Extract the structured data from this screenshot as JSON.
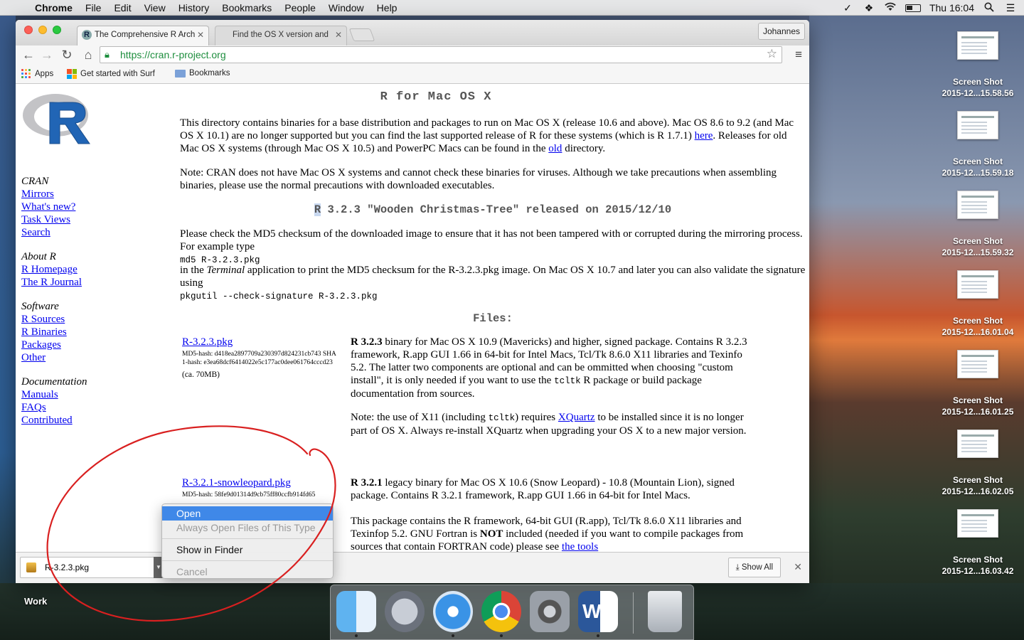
{
  "menubar": {
    "app_name": "Chrome",
    "items": [
      "File",
      "Edit",
      "View",
      "History",
      "Bookmarks",
      "People",
      "Window",
      "Help"
    ],
    "clock": "Thu 16:04"
  },
  "browser": {
    "tabs": [
      {
        "title": "The Comprehensive R Arch",
        "active": true
      },
      {
        "title": "Find the OS X version and",
        "active": false
      }
    ],
    "profile": "Johannes",
    "url": "https://cran.r-project.org",
    "bookmarks": {
      "apps": "Apps",
      "surf": "Get started with Surf",
      "folder": "Bookmarks"
    }
  },
  "sidebar": {
    "cran": {
      "heading": "CRAN",
      "links": [
        "Mirrors",
        "What's new?",
        "Task Views",
        "Search"
      ]
    },
    "about": {
      "heading": "About R",
      "links": [
        "R Homepage",
        "The R Journal"
      ]
    },
    "software": {
      "heading": "Software",
      "links": [
        "R Sources",
        "R Binaries",
        "Packages",
        "Other"
      ]
    },
    "docs": {
      "heading": "Documentation",
      "links": [
        "Manuals",
        "FAQs",
        "Contributed"
      ]
    }
  },
  "content": {
    "title": "R for Mac OS X",
    "intro_1": "This directory contains binaries for a base distribution and packages to run on Mac OS X (release 10.6 and above). Mac OS 8.6 to 9.2 (and Mac OS X 10.1) are no longer supported but you can find the last supported release of R for these systems (which is R 1.7.1) ",
    "intro_link_here": "here",
    "intro_2": ". Releases for old Mac OS X systems (through Mac OS X 10.5) and PowerPC Macs can be found in the ",
    "intro_link_old": "old",
    "intro_3": " directory.",
    "note": "Note: CRAN does not have Mac OS X systems and cannot check these binaries for viruses. Although we take precautions when assembling binaries, please use the normal precautions with downloaded executables.",
    "release_r": "R",
    "release_rest": " 3.2.3 \"Wooden Christmas-Tree\" released on 2015/12/10",
    "md5_text": "Please check the MD5 checksum of the downloaded image to ensure that it has not been tampered with or corrupted during the mirroring process. For example type",
    "md5_cmd": "md5 R-3.2.3.pkg",
    "in_the": "in the ",
    "terminal": "Terminal",
    "md5_after": " application to print the MD5 checksum for the R-3.2.3.pkg image. On Mac OS X 10.7 and later you can also validate the signature using",
    "pkgutil_cmd": "pkgutil --check-signature R-3.2.3.pkg",
    "files_heading": "Files:",
    "file1": {
      "name": "R-3.2.3.pkg",
      "hash": "MD5-hash: d418ea2897709a230397d824231cb743 SHA1-hash: e3ea68dcf6414022e5c177ac0dee061764cccd23",
      "size": "(ca. 70MB)",
      "desc_bold": "R 3.2.3",
      "desc": " binary for Mac OS X 10.9 (Mavericks) and higher, signed package. Contains R 3.2.3 framework, R.app GUI 1.66 in 64-bit for Intel Macs, Tcl/Tk 8.6.0 X11 libraries and Texinfo 5.2. The latter two components are optional and can be ommitted when choosing \"custom install\", it is only needed if you want to use the ",
      "desc_mono": "tcltk",
      "desc_end": " R package or build package documentation from sources.",
      "note_1": "Note: the use of X11 (including ",
      "note_mono": "tcltk",
      "note_2": ") requires ",
      "note_link": "XQuartz",
      "note_3": " to be installed since it is no longer part of OS X. Always re-install XQuartz when upgrading your OS X to a new major version."
    },
    "file2": {
      "name": "R-3.2.1-snowleopard.pkg",
      "hash": "MD5-hash: 58fe9d01314d9cb75ff80ccfb914fd65",
      "desc_bold": "R 3.2.1",
      "desc": " legacy binary for Mac OS X 10.6 (Snow Leopard) - 10.8 (Mountain Lion), signed package. Contains R 3.2.1 framework, R.app GUI 1.66 in 64-bit for Intel Macs.",
      "desc2_a": "This package contains the R framework, 64-bit GUI (R.app), Tcl/Tk 8.6.0 X11 libraries and Texinfop 5.2. GNU Fortran is ",
      "desc2_bold": "NOT",
      "desc2_b": " included (needed if you want to compile packages from sources that contain FORTRAN code) please see ",
      "desc2_link": "the tools"
    }
  },
  "download_shelf": {
    "file": "R-3.2.3.pkg",
    "show_all": "Show All"
  },
  "context_menu": {
    "open": "Open",
    "always_open": "Always Open Files of This Type",
    "show_in_finder": "Show in Finder",
    "cancel": "Cancel"
  },
  "desktop": {
    "icons": [
      {
        "title": "Screen Shot",
        "date": "2015-12...15.58.56"
      },
      {
        "title": "Screen Shot",
        "date": "2015-12...15.59.18"
      },
      {
        "title": "Screen Shot",
        "date": "2015-12...15.59.32"
      },
      {
        "title": "Screen Shot",
        "date": "2015-12...16.01.04"
      },
      {
        "title": "Screen Shot",
        "date": "2015-12...16.01.25"
      },
      {
        "title": "Screen Shot",
        "date": "2015-12...16.02.05"
      },
      {
        "title": "Screen Shot",
        "date": "2015-12...16.03.42"
      }
    ],
    "work_label": "Work"
  },
  "dock": {
    "apps": [
      "finder-icon",
      "launchpad-icon",
      "safari-icon",
      "chrome-icon",
      "system-preferences-icon",
      "word-icon",
      "trash-icon"
    ]
  },
  "colors": {
    "link": "#0000ee",
    "annotation": "#d92020",
    "menu_highlight": "#3f88e8"
  }
}
